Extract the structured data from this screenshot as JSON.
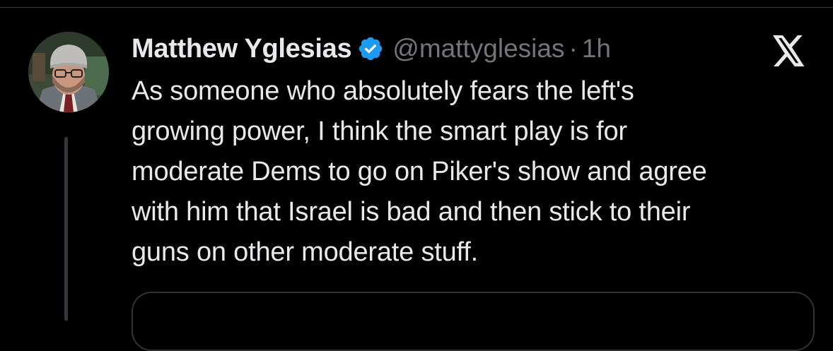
{
  "tweet": {
    "author_name": "Matthew Yglesias",
    "handle": "@mattyglesias",
    "separator": "·",
    "time": "1h",
    "text": "As someone who absolutely fears the left's\ngrowing power, I think the smart play is for\nmoderate Dems to go on Piker's show and agree\nwith him that Israel is bad and then stick to their\nguns on other moderate stuff.",
    "verified": true
  },
  "icons": {
    "verified": "verified-badge-icon",
    "platform": "x-logo-icon"
  },
  "colors": {
    "background": "#000000",
    "text_primary": "#e7e9ea",
    "text_secondary": "#71767b",
    "verified_blue": "#1d9bf0",
    "border": "#2f3336"
  }
}
